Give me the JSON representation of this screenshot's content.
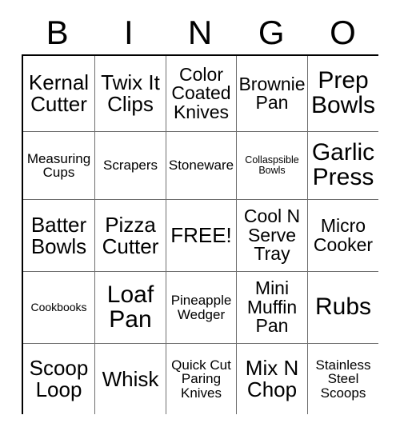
{
  "card": {
    "title": "BINGO",
    "free_space_label": "FREE!",
    "header_letters": [
      "B",
      "I",
      "N",
      "G",
      "O"
    ],
    "columns": 5,
    "rows": 5,
    "colors": {
      "background": "#ffffff",
      "text": "#000000",
      "grid_border": "#000000",
      "grid_line": "#6e6e6e"
    },
    "squares": [
      [
        {
          "text": "Kernal Cutter",
          "size": "lg"
        },
        {
          "text": "Twix It Clips",
          "size": "lg"
        },
        {
          "text": "Color Coated Knives",
          "size": "md"
        },
        {
          "text": "Brownie Pan",
          "size": "md"
        },
        {
          "text": "Prep Bowls",
          "size": "xl"
        }
      ],
      [
        {
          "text": "Measuring Cups",
          "size": "sm"
        },
        {
          "text": "Scrapers",
          "size": "sm"
        },
        {
          "text": "Stoneware",
          "size": "sm"
        },
        {
          "text": "Collaspsible Bowls",
          "size": "xxs"
        },
        {
          "text": "Garlic Press",
          "size": "xl"
        }
      ],
      [
        {
          "text": "Batter Bowls",
          "size": "lg"
        },
        {
          "text": "Pizza Cutter",
          "size": "lg"
        },
        {
          "text": "FREE!",
          "size": "lg"
        },
        {
          "text": "Cool N Serve Tray",
          "size": "md"
        },
        {
          "text": "Micro Cooker",
          "size": "md"
        }
      ],
      [
        {
          "text": "Cookbooks",
          "size": "xs"
        },
        {
          "text": "Loaf Pan",
          "size": "xl"
        },
        {
          "text": "Pineapple Wedger",
          "size": "sm"
        },
        {
          "text": "Mini Muffin Pan",
          "size": "md"
        },
        {
          "text": "Rubs",
          "size": "xl"
        }
      ],
      [
        {
          "text": "Scoop Loop",
          "size": "lg"
        },
        {
          "text": "Whisk",
          "size": "lg"
        },
        {
          "text": "Quick Cut Paring Knives",
          "size": "sm"
        },
        {
          "text": "Mix N Chop",
          "size": "lg"
        },
        {
          "text": "Stainless Steel Scoops",
          "size": "sm"
        }
      ]
    ]
  }
}
